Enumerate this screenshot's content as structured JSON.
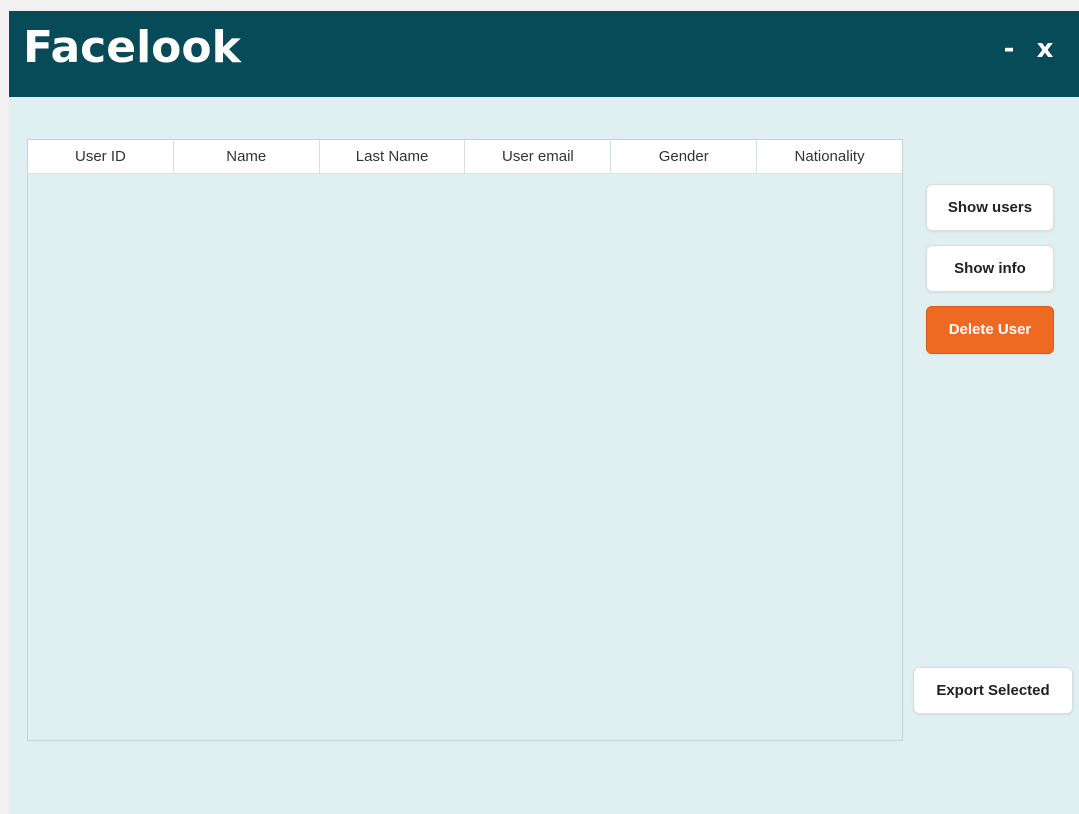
{
  "window": {
    "title": "Facelook",
    "minimize_label": "-",
    "close_label": "x"
  },
  "table": {
    "columns": [
      "User ID",
      "Name",
      "Last Name",
      "User email",
      "Gender",
      "Nationality"
    ],
    "rows": []
  },
  "buttons": {
    "show_users": "Show users",
    "show_info": "Show info",
    "delete_user": "Delete User",
    "export_selected": "Export Selected"
  },
  "colors": {
    "titlebar": "#064b57",
    "background": "#e0f0f0",
    "danger": "#ee6a23"
  }
}
